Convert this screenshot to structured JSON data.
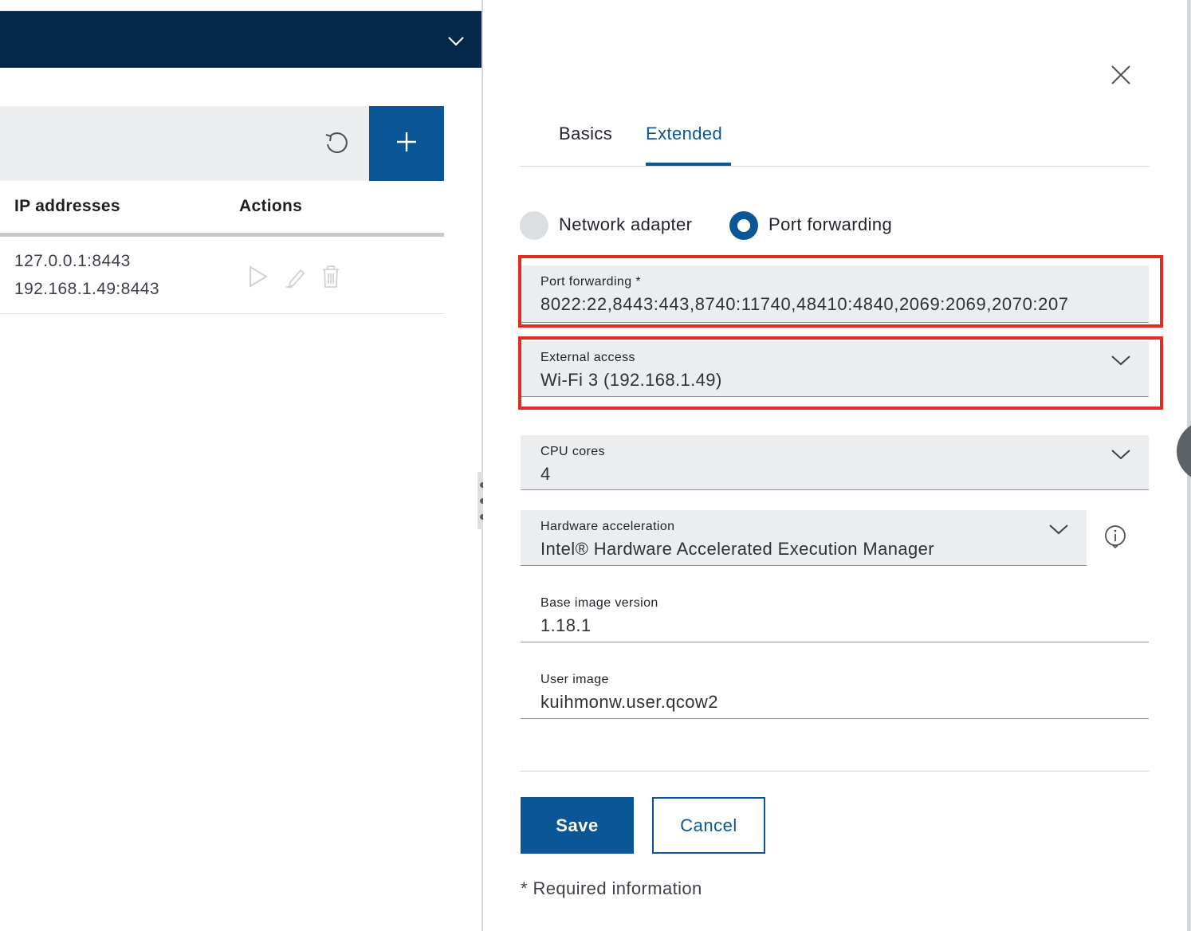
{
  "table": {
    "headers": {
      "ip": "IP addresses",
      "actions": "Actions"
    },
    "rows": [
      {
        "ip_lines": [
          "127.0.0.1:8443",
          "192.168.1.49:8443"
        ]
      }
    ]
  },
  "tabs": [
    {
      "label": "Basics",
      "active": false
    },
    {
      "label": "Extended",
      "active": true
    }
  ],
  "network_mode": {
    "options": [
      "Network adapter",
      "Port forwarding"
    ],
    "selected": "Port forwarding"
  },
  "fields": {
    "port_forwarding": {
      "label": "Port forwarding *",
      "value": "8022:22,8443:443,8740:11740,48410:4840,2069:2069,2070:207"
    },
    "external_access": {
      "label": "External access",
      "value": "Wi-Fi 3 (192.168.1.49)"
    },
    "cpu_cores": {
      "label": "CPU cores",
      "value": "4"
    },
    "hardware_acceleration": {
      "label": "Hardware acceleration",
      "value": "Intel® Hardware Accelerated Execution Manager"
    },
    "base_image_version": {
      "label": "Base image version",
      "value": "1.18.1"
    },
    "user_image": {
      "label": "User image",
      "value": "kuihmonw.user.qcow2"
    }
  },
  "buttons": {
    "save": "Save",
    "cancel": "Cancel"
  },
  "required_note": "* Required information",
  "icons": {
    "header_chevron": "chevron-down-icon",
    "refresh": "refresh-icon",
    "add": "plus-icon",
    "play": "play-icon",
    "edit": "pencil-icon",
    "delete": "trash-icon",
    "close": "close-icon",
    "info": "info-icon"
  },
  "colors": {
    "primary": "#0a5696",
    "header_dark": "#05274a",
    "highlight": "#e32b24",
    "field_bg": "#ebedee"
  }
}
